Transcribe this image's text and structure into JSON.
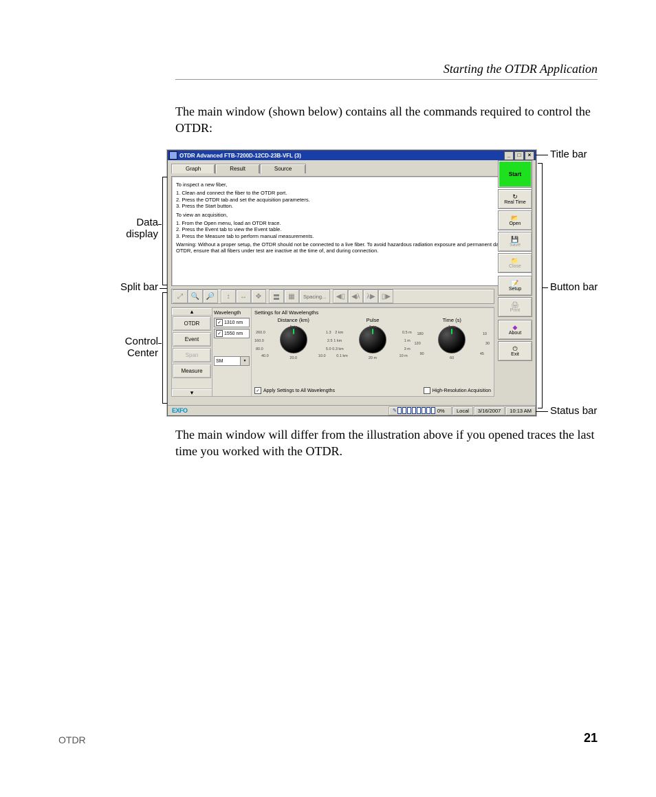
{
  "doc": {
    "section_title": "Starting the OTDR Application",
    "intro": "The main window (shown below) contains all the commands required to control the OTDR:",
    "outro": "The main window will differ from the illustration above if you opened traces the last time you worked with the OTDR.",
    "footer_left": "OTDR",
    "footer_page": "21"
  },
  "callouts": {
    "title_bar": "Title bar",
    "data_display": "Data display",
    "split_bar": "Split bar",
    "control_center": "Control Center",
    "button_bar": "Button bar",
    "status_bar": "Status bar"
  },
  "app": {
    "title": "OTDR Advanced FTB-7200D-12CD-23B-VFL (3)",
    "tabs": {
      "graph": "Graph",
      "result": "Result",
      "source": "Source"
    },
    "instructions": {
      "p1": "To inspect a new fiber,",
      "p1l1": "1. Clean and connect the fiber to the OTDR port.",
      "p1l2": "2. Press the OTDR tab and set the acquisition parameters.",
      "p1l3": "3. Press the Start button.",
      "p2": "To view an acquisition,",
      "p2l1": "1. From the Open menu, load an OTDR trace.",
      "p2l2": "2. Press the Event tab to view the Event table.",
      "p2l3": "3. Press the Measure tab to perform manual measurements.",
      "warn": "Warning: Without a proper setup, the OTDR should not be connected to a live fiber. To avoid hazardous radiation exposure and permanent damage to the OTDR, ensure that all fibers under test are inactive at the time of, and during connection."
    },
    "buttons": {
      "start": "Start",
      "realtime": "Real Time",
      "open": "Open",
      "save": "Save",
      "close": "Close",
      "setup": "Setup",
      "print": "Print",
      "about": "About",
      "exit": "Exit"
    },
    "toolbar": {
      "spacing": "Spacing..."
    },
    "cc": {
      "tabs": {
        "otdr": "OTDR",
        "event": "Event",
        "span": "Span",
        "measure": "Measure"
      },
      "wavelength_header": "Wavelength",
      "wl_1310": "1310 nm",
      "wl_1550": "1550 nm",
      "sm": "SM",
      "settings_header": "Settings for All Wavelengths",
      "distance_label": "Distance (km)",
      "pulse_label": "Pulse",
      "time_label": "Time (s)",
      "apply_all": "Apply Settings to All Wavelengths",
      "high_res": "High-Resolution Acquisition",
      "distance_scale": {
        "auto": "Auto",
        "v260": "260.0",
        "v13": "1.3",
        "v160": "160.0",
        "v25": "2.5",
        "v80": "80.0",
        "v5": "5.0",
        "v40": "40.0",
        "v20": "20.0",
        "v10": "10.0"
      },
      "pulse_scale": {
        "auto": "Auto",
        "v2km": "2 km",
        "v05m": "0.5 m",
        "v1km": "1 km",
        "v1m": "1 m",
        "v03km": "0.3 km",
        "v3m": "3 m",
        "v01km": "0.1 km",
        "v20m": "20 m",
        "v10m": "10 m"
      },
      "time_scale": {
        "auto": "Auto",
        "v180": "180",
        "v10": "10",
        "v120": "120",
        "v30": "30",
        "v90": "90",
        "v45": "45",
        "v60": "60"
      }
    },
    "status": {
      "logo": "EXFO",
      "percent": "0%",
      "local": "Local",
      "date": "3/16/2007",
      "time": "10:13 AM"
    }
  }
}
